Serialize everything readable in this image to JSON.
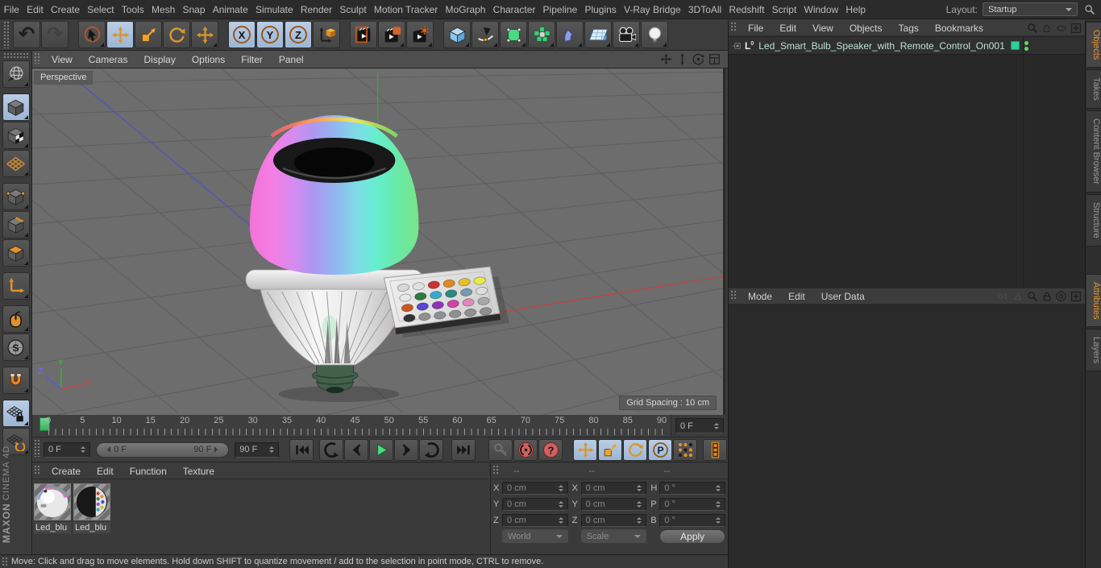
{
  "menubar": {
    "items": [
      "File",
      "Edit",
      "Create",
      "Select",
      "Tools",
      "Mesh",
      "Snap",
      "Animate",
      "Simulate",
      "Render",
      "Sculpt",
      "Motion Tracker",
      "MoGraph",
      "Character",
      "Pipeline",
      "Plugins",
      "V-Ray Bridge",
      "3DToAll",
      "Redshift",
      "Script",
      "Window",
      "Help"
    ],
    "layout_label": "Layout:",
    "layout_value": "Startup"
  },
  "toolbar": {
    "groups": [
      [
        {
          "name": "undo",
          "icon": "undo"
        },
        {
          "name": "redo",
          "icon": "redo",
          "disabled": true
        }
      ],
      [
        {
          "name": "live-selection",
          "icon": "cursor",
          "corner": true
        },
        {
          "name": "move",
          "icon": "move",
          "active": true
        },
        {
          "name": "scale",
          "icon": "scale"
        },
        {
          "name": "rotate",
          "icon": "rotate"
        },
        {
          "name": "last-tool",
          "icon": "move",
          "corner": true
        }
      ],
      [
        {
          "name": "lock-x-axis",
          "icon": "axis-x",
          "active": true
        },
        {
          "name": "lock-y-axis",
          "icon": "axis-y",
          "active": true
        },
        {
          "name": "lock-z-axis",
          "icon": "axis-z",
          "active": true
        },
        {
          "name": "coordinate-system",
          "icon": "coordsys"
        }
      ],
      [
        {
          "name": "render-view",
          "icon": "render-view"
        },
        {
          "name": "render-picture-viewer",
          "icon": "render-picture",
          "corner": true
        },
        {
          "name": "render-settings",
          "icon": "render-settings",
          "corner": true
        }
      ],
      [
        {
          "name": "add-primitive",
          "icon": "cube",
          "corner": true
        },
        {
          "name": "add-spline",
          "icon": "pen",
          "corner": true
        },
        {
          "name": "add-generator",
          "icon": "subdiv",
          "corner": true
        },
        {
          "name": "add-mograph",
          "icon": "cloner",
          "corner": true
        },
        {
          "name": "add-field",
          "icon": "field",
          "corner": true
        },
        {
          "name": "add-environment",
          "icon": "floor",
          "corner": true
        },
        {
          "name": "add-camera",
          "icon": "camera",
          "corner": true
        },
        {
          "name": "add-light",
          "icon": "light",
          "corner": true
        }
      ]
    ]
  },
  "sidebar": {
    "groups": [
      [
        {
          "name": "convert",
          "icon": "globe"
        }
      ],
      [
        {
          "name": "model-mode",
          "icon": "cube-model",
          "active": true
        },
        {
          "name": "texture-mode",
          "icon": "cube-texture"
        },
        {
          "name": "workplane-mode",
          "icon": "workplane"
        }
      ],
      [
        {
          "name": "points-mode",
          "icon": "cube-points"
        },
        {
          "name": "edges-mode",
          "icon": "cube-edges"
        },
        {
          "name": "polygons-mode",
          "icon": "cube-polys"
        }
      ],
      [
        {
          "name": "enable-axis-modification",
          "icon": "axis-mod"
        }
      ],
      [
        {
          "name": "tweak-mode",
          "icon": "mouse"
        },
        {
          "name": "snap-settings",
          "icon": "snap-s"
        }
      ],
      [
        {
          "name": "enable-snap",
          "icon": "magnet"
        }
      ],
      [
        {
          "name": "lock-workplane",
          "icon": "workplane-lock",
          "active": true
        },
        {
          "name": "planar-workplane",
          "icon": "workplane-rotate"
        }
      ]
    ],
    "brand_line1": "MAXON",
    "brand_line2": "CINEMA 4D"
  },
  "viewport": {
    "menu": [
      "View",
      "Cameras",
      "Display",
      "Options",
      "Filter",
      "Panel"
    ],
    "nav_icons": [
      {
        "name": "pan-view",
        "icon": "pan"
      },
      {
        "name": "dolly-view",
        "icon": "dolly"
      },
      {
        "name": "orbit-view",
        "icon": "orbit"
      },
      {
        "name": "toggle-view-layout",
        "icon": "toggle-layout"
      }
    ],
    "camera_label": "Perspective",
    "grid_spacing_label": "Grid Spacing : 10 cm",
    "axis_labels": {
      "x": "X",
      "y": "Y",
      "z": "Z"
    },
    "scene": {
      "bulb_gradient": [
        "#f173d8",
        "#f57de2",
        "#d88aef",
        "#ae97f2",
        "#93b4f0",
        "#7fd9e8",
        "#66efcf",
        "#68e9a8",
        "#79e488"
      ],
      "remote_key_colors": [
        [
          "#d8d8d8",
          "#e8e8e8",
          "#cc5522",
          "#333333"
        ],
        [
          "#e0e0e0",
          "#2e7a3e",
          "#5a48d0",
          "#909090"
        ],
        [
          "#cc3333",
          "#3aa8cc",
          "#8c35bb",
          "#909090"
        ],
        [
          "#e08822",
          "#2a8a80",
          "#cc44aa",
          "#909090"
        ],
        [
          "#e6c02a",
          "#7a99aa",
          "#e088bb",
          "#909090"
        ],
        [
          "#eaea4a",
          "#dcdcdc",
          "#a8a8a8",
          "#909090"
        ]
      ]
    }
  },
  "timeline": {
    "ruler_labels": [
      "0",
      "5",
      "10",
      "15",
      "20",
      "25",
      "30",
      "35",
      "40",
      "45",
      "50",
      "55",
      "60",
      "65",
      "70",
      "75",
      "80",
      "85",
      "90"
    ],
    "frame_field": "0 F"
  },
  "transport": {
    "current": "0 F",
    "range_start": "0 F",
    "range_end": "90 F",
    "end": "90 F",
    "button_groups": [
      [
        {
          "name": "goto-start",
          "icon": "skip-start"
        }
      ],
      [
        {
          "name": "goto-previous-key",
          "icon": "arc-ccw"
        },
        {
          "name": "goto-previous-frame",
          "icon": "step-back"
        },
        {
          "name": "play-forwards",
          "icon": "play"
        },
        {
          "name": "goto-next-frame",
          "icon": "step-fwd"
        },
        {
          "name": "goto-next-key",
          "icon": "arc-cw"
        }
      ],
      [
        {
          "name": "goto-end",
          "icon": "skip-end"
        }
      ],
      [
        {
          "name": "keyframe-selection",
          "icon": "key",
          "disabled": true
        },
        {
          "name": "record-active-objects",
          "icon": "record"
        },
        {
          "name": "autokeying",
          "icon": "question"
        }
      ],
      [
        {
          "name": "keyframe-position",
          "icon": "move",
          "active": true
        },
        {
          "name": "keyframe-scale",
          "icon": "scale",
          "active": true
        },
        {
          "name": "keyframe-rotation",
          "icon": "rotate",
          "active": true
        },
        {
          "name": "keyframe-parameter",
          "icon": "p-circle",
          "active": true
        },
        {
          "name": "keyframe-pla",
          "icon": "dots-grid"
        }
      ],
      [
        {
          "name": "open-timeline",
          "icon": "film"
        }
      ]
    ]
  },
  "materials": {
    "menu": [
      "Create",
      "Edit",
      "Function",
      "Texture"
    ],
    "items": [
      {
        "label": "Led_blu",
        "variant": "bulb"
      },
      {
        "label": "Led_blu",
        "variant": "remote"
      }
    ]
  },
  "coordinates": {
    "columns": [
      {
        "header": "--",
        "rows": [
          {
            "label": "X",
            "value": "0 cm"
          },
          {
            "label": "Y",
            "value": "0 cm"
          },
          {
            "label": "Z",
            "value": "0 cm"
          }
        ],
        "footer": {
          "type": "select",
          "value": "World"
        }
      },
      {
        "header": "--",
        "rows": [
          {
            "label": "X",
            "value": "0 cm"
          },
          {
            "label": "Y",
            "value": "0 cm"
          },
          {
            "label": "Z",
            "value": "0 cm"
          }
        ],
        "footer": {
          "type": "select",
          "value": "Scale"
        }
      },
      {
        "header": "--",
        "rows": [
          {
            "label": "H",
            "value": "0 °"
          },
          {
            "label": "P",
            "value": "0 °"
          },
          {
            "label": "B",
            "value": "0 °"
          }
        ],
        "footer": {
          "type": "button",
          "value": "Apply"
        }
      }
    ]
  },
  "object_manager": {
    "menu": [
      "File",
      "Edit",
      "View",
      "Objects",
      "Tags",
      "Bookmarks"
    ],
    "icons": [
      {
        "name": "om-search",
        "icon": "magnifier"
      },
      {
        "name": "om-home",
        "icon": "home"
      },
      {
        "name": "om-filter",
        "icon": "eye"
      },
      {
        "name": "om-add-panel",
        "icon": "plus-box"
      }
    ],
    "object": {
      "name": "Led_Smart_Bulb_Speaker_with_Remote_Control_On001"
    }
  },
  "attributes_panel": {
    "menu": [
      "Mode",
      "Edit",
      "User Data"
    ],
    "icons": [
      {
        "name": "attr-history-back",
        "icon": "hist-prev",
        "disabled": true
      },
      {
        "name": "attr-history-up",
        "icon": "hist-tri",
        "disabled": true
      },
      {
        "name": "attr-search",
        "icon": "magnifier"
      },
      {
        "name": "attr-lock",
        "icon": "lock"
      },
      {
        "name": "attr-target",
        "icon": "target"
      },
      {
        "name": "attr-add-panel",
        "icon": "plus-box"
      }
    ]
  },
  "side_tabs": {
    "top": [
      {
        "label": "Objects",
        "active": true
      },
      {
        "label": "Takes"
      },
      {
        "label": "Content Browser"
      },
      {
        "label": "Structure"
      }
    ],
    "bottom": [
      {
        "label": "Attributes",
        "active": true
      },
      {
        "label": "Layers"
      }
    ]
  },
  "statusbar": {
    "text": "Move: Click and drag to move elements. Hold down SHIFT to quantize movement / add to the selection in point mode, CTRL to remove."
  },
  "colors": {
    "accent_orange": "#e8952f",
    "active_blue": "#a9c3de",
    "play_green": "#49dd77",
    "record_red": "#cf6060",
    "object_green": "#2fcf9d",
    "viewport_gray": "#6d6d6d"
  }
}
